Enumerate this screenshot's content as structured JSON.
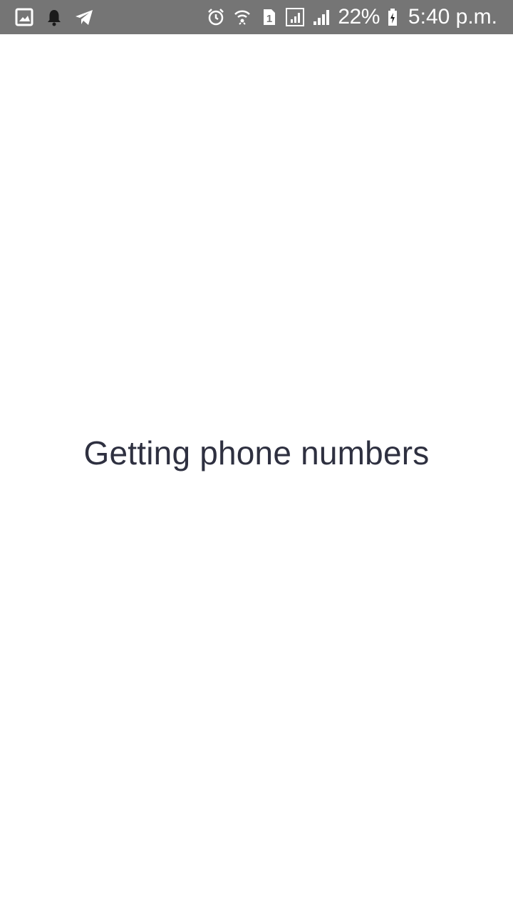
{
  "status_bar": {
    "left_icons": [
      "gallery-icon",
      "notification-bell-icon",
      "telegram-icon"
    ],
    "right_icons": [
      "alarm-icon",
      "wifi-icon",
      "sim1-icon",
      "signal-icon",
      "signal-icon"
    ],
    "battery_percent": "22%",
    "time": "5:40 p.m."
  },
  "main": {
    "message": "Getting phone numbers"
  },
  "colors": {
    "status_bar_bg": "#757575",
    "background": "#ffffff",
    "message_text": "#2e3040"
  }
}
